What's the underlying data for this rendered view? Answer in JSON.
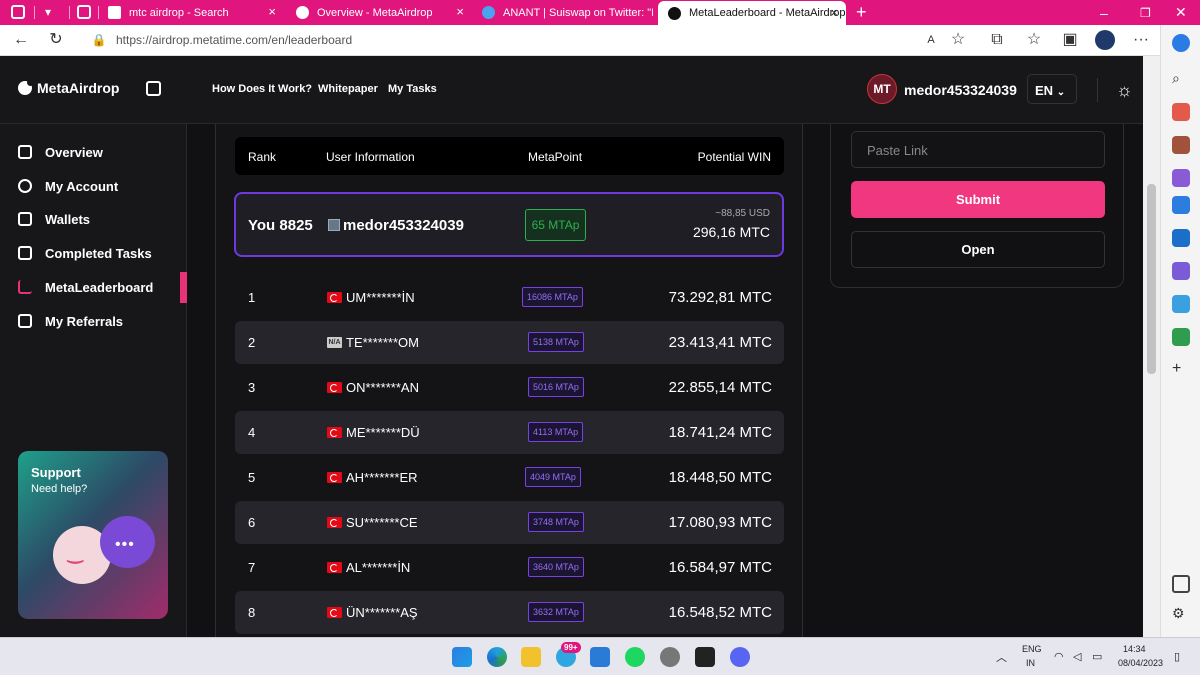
{
  "browser": {
    "tabs": [
      {
        "title": "mtc airdrop - Search",
        "active": false
      },
      {
        "title": "Overview - MetaAirdrop",
        "active": false
      },
      {
        "title": "ANANT | Suiswap on Twitter: \"Me",
        "active": false
      },
      {
        "title": "MetaLeaderboard - MetaAirdrop",
        "active": true
      }
    ],
    "url": "https://airdrop.metatime.com/en/leaderboard"
  },
  "header": {
    "logo": "MetaAirdrop",
    "links": [
      "How Does It Work?",
      "Whitepaper",
      "My Tasks"
    ],
    "avatar_initials": "MT",
    "username": "medor453324039",
    "language": "EN"
  },
  "sidebar": {
    "items": [
      {
        "label": "Overview"
      },
      {
        "label": "My Account"
      },
      {
        "label": "Wallets"
      },
      {
        "label": "Completed Tasks"
      },
      {
        "label": "MetaLeaderboard"
      },
      {
        "label": "My Referrals"
      }
    ],
    "support": {
      "title": "Support",
      "subtitle": "Need help?"
    }
  },
  "leaderboard": {
    "headers": {
      "rank": "Rank",
      "user": "User Information",
      "points": "MetaPoint",
      "win": "Potential WIN"
    },
    "you": {
      "rank": "You 8825",
      "name": "medor453324039",
      "points": "65 MTAp",
      "usd": "~88,85 USD",
      "win": "296,16 MTC"
    },
    "rows": [
      {
        "rank": "1",
        "flag": "TR",
        "name": "UM*******İN",
        "points": "16086 MTAp",
        "win": "73.292,81 MTC"
      },
      {
        "rank": "2",
        "flag": "N/A",
        "name": "TE*******OM",
        "points": "5138 MTAp",
        "win": "23.413,41 MTC"
      },
      {
        "rank": "3",
        "flag": "TR",
        "name": "ON*******AN",
        "points": "5016 MTAp",
        "win": "22.855,14 MTC"
      },
      {
        "rank": "4",
        "flag": "TR",
        "name": "ME*******DÜ",
        "points": "4113 MTAp",
        "win": "18.741,24 MTC"
      },
      {
        "rank": "5",
        "flag": "TR",
        "name": "AH*******ER",
        "points": "4049 MTAp",
        "win": "18.448,50 MTC"
      },
      {
        "rank": "6",
        "flag": "TR",
        "name": "SU*******CE",
        "points": "3748 MTAp",
        "win": "17.080,93 MTC"
      },
      {
        "rank": "7",
        "flag": "TR",
        "name": "AL*******İN",
        "points": "3640 MTAp",
        "win": "16.584,97 MTC"
      },
      {
        "rank": "8",
        "flag": "TR",
        "name": "ÜN*******AŞ",
        "points": "3632 MTAp",
        "win": "16.548,52 MTC"
      }
    ]
  },
  "task_form": {
    "placeholder": "Paste Link",
    "submit": "Submit",
    "open": "Open"
  },
  "taskbar": {
    "badge": "99+",
    "lang1": "ENG",
    "lang2": "IN",
    "time": "14:34",
    "date": "08/04/2023"
  }
}
